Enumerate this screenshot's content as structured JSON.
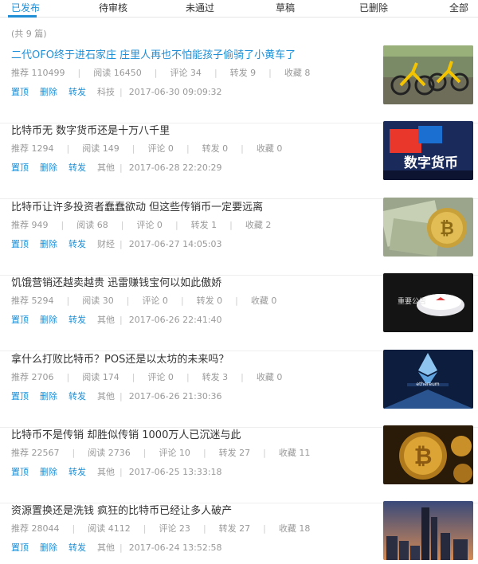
{
  "tabs": [
    {
      "label": "已发布",
      "active": true
    },
    {
      "label": "待审核",
      "active": false
    },
    {
      "label": "未通过",
      "active": false
    },
    {
      "label": "草稿",
      "active": false
    },
    {
      "label": "已删除",
      "active": false
    },
    {
      "label": "全部",
      "active": false
    }
  ],
  "total_text": "(共 9 篇)",
  "labels": {
    "recommend": "推荐",
    "read": "阅读",
    "comment": "评论",
    "share": "转发",
    "collect": "收藏",
    "pin": "置顶",
    "delete": "删除",
    "forward": "转发"
  },
  "accent_color": "#1e8fd6",
  "articles": [
    {
      "title": "二代OFO终于进石家庄 庄里人再也不怕能孩子偷骑了小黄车了",
      "recommend": "110499",
      "read": "16450",
      "comment": "34",
      "share": "9",
      "collect": "8",
      "category": "科技",
      "date": "2017-06-30 09:09:32",
      "thumb": "yellow-bikes"
    },
    {
      "title": "比特币无 数字货币还是十万八千里",
      "recommend": "1294",
      "read": "149",
      "comment": "0",
      "share": "0",
      "collect": "0",
      "category": "其他",
      "date": "2017-06-28 22:20:29",
      "thumb": "digital-currency"
    },
    {
      "title": "比特币让许多投资者蠢蠢欲动 但这些传销币一定要远离",
      "recommend": "949",
      "read": "68",
      "comment": "0",
      "share": "1",
      "collect": "2",
      "category": "财经",
      "date": "2017-06-27 14:05:03",
      "thumb": "bitcoin-dollars"
    },
    {
      "title": "饥饿营销还越卖越贵 迅雷赚钱宝何以如此傲娇",
      "recommend": "5294",
      "read": "30",
      "comment": "0",
      "share": "0",
      "collect": "0",
      "category": "其他",
      "date": "2017-06-26 22:41:40",
      "thumb": "router-device",
      "thumb_caption": "重要公告"
    },
    {
      "title": "拿什么打败比特币？POS还是以太坊的未来吗？",
      "recommend": "2706",
      "read": "174",
      "comment": "0",
      "share": "3",
      "collect": "0",
      "category": "其他",
      "date": "2017-06-26 21:30:36",
      "thumb": "ethereum",
      "thumb_caption": "ethereum"
    },
    {
      "title": "比特币不是传销 却胜似传销 1000万人已沉迷与此",
      "recommend": "22567",
      "read": "2736",
      "comment": "10",
      "share": "27",
      "collect": "11",
      "category": "其他",
      "date": "2017-06-25 13:33:18",
      "thumb": "bitcoin-gold"
    },
    {
      "title": "资源置换还是洗钱 疯狂的比特币已经让多人破产",
      "recommend": "28044",
      "read": "4112",
      "comment": "23",
      "share": "27",
      "collect": "18",
      "category": "其他",
      "date": "2017-06-24 13:52:58",
      "thumb": "city-skyline"
    }
  ]
}
